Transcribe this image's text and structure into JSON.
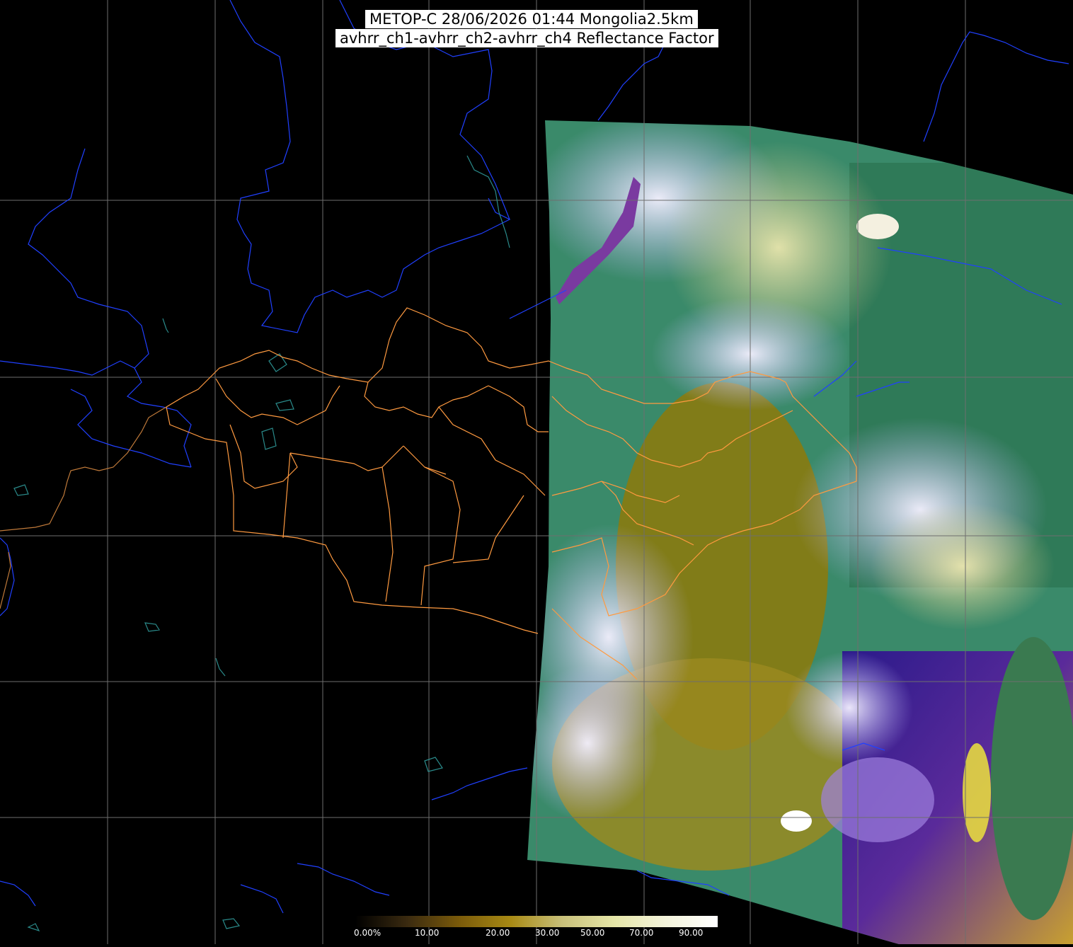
{
  "title": {
    "line1": "METOP-C 28/06/2026 01:44 Mongolia2.5km",
    "line2": "avhrr_ch1-avhrr_ch2-avhrr_ch4 Reflectance Factor"
  },
  "colorbar": {
    "labels": [
      "0.00%",
      "10.00",
      "20.00",
      "30.00",
      "50.00",
      "70.00",
      "90.00"
    ],
    "colors": [
      "#000000",
      "#3a2a10",
      "#7a5a0a",
      "#a88a14",
      "#c8c07a",
      "#e6e6a8",
      "#f4f4dc",
      "#ffffff"
    ]
  },
  "colors": {
    "background": "#000000",
    "grid": "#6e6e6e",
    "rivers": "#2040ff",
    "lakes_outline": "#2a8a8a",
    "admin_borders": "#ffa040",
    "province_borders": "#ff9a40"
  }
}
